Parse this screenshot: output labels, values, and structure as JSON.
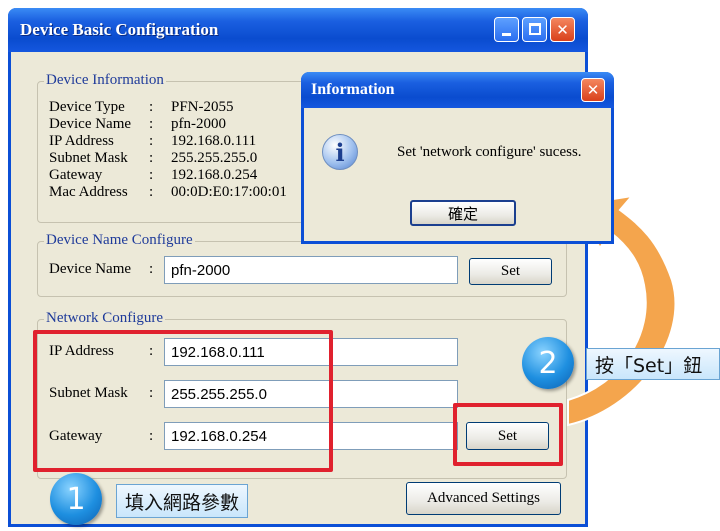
{
  "window": {
    "title": "Device Basic Configuration"
  },
  "device_info": {
    "legend": "Device Information",
    "rows": [
      {
        "label": "Device Type",
        "sep": ":",
        "value": "PFN-2055"
      },
      {
        "label": "Device Name",
        "sep": ":",
        "value": "pfn-2000"
      },
      {
        "label": "IP Address",
        "sep": ":",
        "value": "192.168.0.111"
      },
      {
        "label": "Subnet Mask",
        "sep": ":",
        "value": "255.255.255.0"
      },
      {
        "label": "Gateway",
        "sep": ":",
        "value": "192.168.0.254"
      },
      {
        "label": "Mac Address",
        "sep": ":",
        "value": "00:0D:E0:17:00:01"
      }
    ]
  },
  "name_config": {
    "legend": "Device Name Configure",
    "label": "Device Name",
    "sep": ":",
    "value": "pfn-2000",
    "set_label": "Set"
  },
  "network_config": {
    "legend": "Network Configure",
    "ip_label": "IP Address",
    "ip_value": "192.168.0.111",
    "mask_label": "Subnet Mask",
    "mask_value": "255.255.255.0",
    "gw_label": "Gateway",
    "gw_value": "192.168.0.254",
    "sep": ":",
    "set_label": "Set",
    "advanced_label": "Advanced Settings"
  },
  "info_dialog": {
    "title": "Information",
    "message": "Set 'network configure' sucess.",
    "ok_label": "確定"
  },
  "callouts": {
    "step1_number": "1",
    "step1_text": "填入網路參數",
    "step2_number": "2",
    "step2_text": "按「Set」鈕"
  },
  "colors": {
    "highlight": "#e0212e",
    "callout_blue": "#1e8fe0",
    "arrow_orange": "#f19a3e"
  }
}
